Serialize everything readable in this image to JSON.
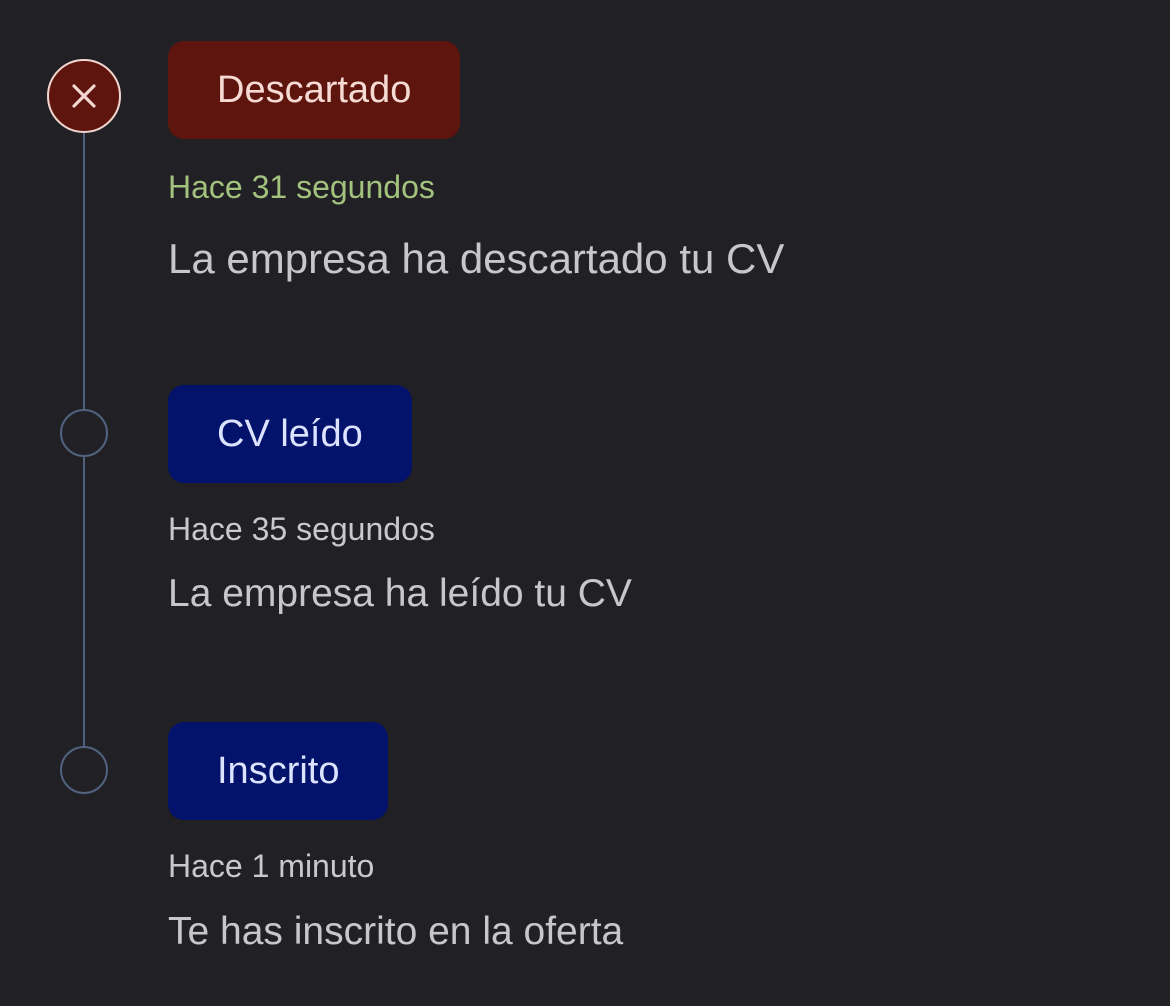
{
  "timeline": {
    "events": [
      {
        "status": "Descartado",
        "time": "Hace 31 segundos",
        "description": "La empresa ha descartado tu CV",
        "icon": "close-icon"
      },
      {
        "status": "CV leído",
        "time": "Hace 35 segundos",
        "description": "La empresa ha leído tu CV",
        "icon": "empty-circle-icon"
      },
      {
        "status": "Inscrito",
        "time": "Hace 1 minuto",
        "description": "Te has inscrito en la oferta",
        "icon": "empty-circle-icon"
      }
    ]
  },
  "colors": {
    "background": "#212025",
    "discarded": "#5d150d",
    "info": "#03126a",
    "latest_time": "#a2c27d",
    "line": "#4d5f7d"
  }
}
